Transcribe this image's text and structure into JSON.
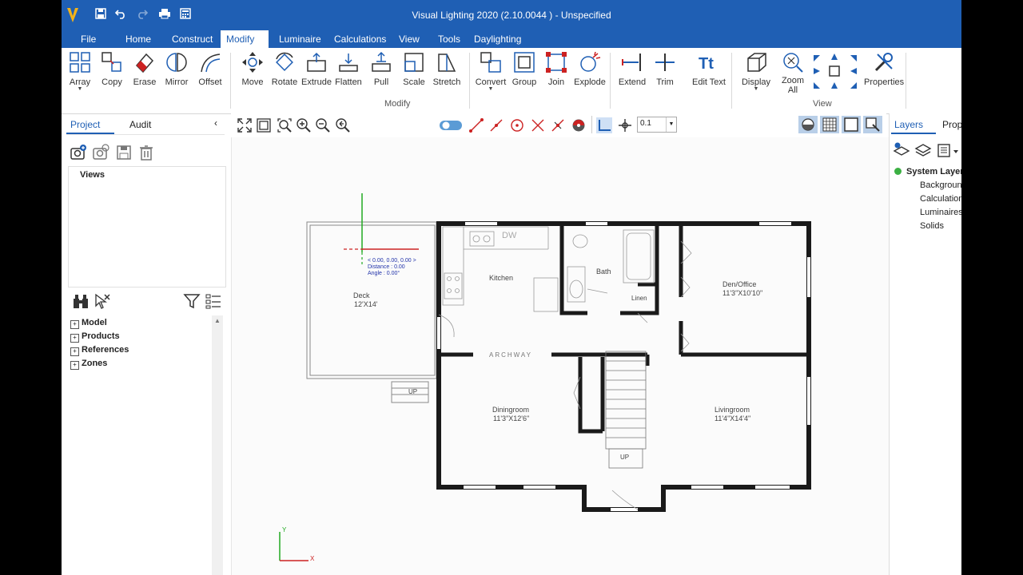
{
  "titlebar": {
    "title": "Visual Lighting 2020 (2.10.0044 ) - Unspecified"
  },
  "menu": [
    "File",
    "Home",
    "Construct",
    "Modify",
    "Luminaire",
    "Calculations",
    "View",
    "Tools",
    "Daylighting"
  ],
  "ribbon": {
    "tools": [
      "Array",
      "Copy",
      "Erase",
      "Mirror",
      "Offset",
      "Move",
      "Rotate",
      "Extrude",
      "Flatten",
      "Pull",
      "Scale",
      "Stretch",
      "Convert",
      "Group",
      "Join",
      "Explode",
      "Extend",
      "Trim",
      "Edit Text",
      "Display",
      "Zoom",
      "All",
      "Properties"
    ],
    "groups": {
      "modify": "Modify",
      "view": "View"
    }
  },
  "left_panel": {
    "tabs": [
      "Project",
      "Audit"
    ],
    "views_label": "Views",
    "tree": [
      "Model",
      "Products",
      "References",
      "Zones"
    ]
  },
  "canvas_toolbar": {
    "step_value": "0.1"
  },
  "right_panel": {
    "tabs": [
      "Layers",
      "Prop"
    ],
    "layers": [
      "System Layer",
      "Background",
      "Calculation",
      "Luminaires",
      "Solids"
    ]
  },
  "floorplan": {
    "rooms": {
      "deck": "Deck",
      "deck_dim": "12'X14'",
      "kitchen": "Kitchen",
      "dw": "DW",
      "bath": "Bath",
      "linen": "Linen",
      "den": "Den/Office",
      "den_dim": "11'3\"X10'10\"",
      "archway": "ARCHWAY",
      "dining": "Diningroom",
      "dining_dim": "11'3\"X12'6\"",
      "living": "Livingroom",
      "living_dim": "11'4\"X14'4\"",
      "up": "UP"
    },
    "cursor": {
      "coords": "< 0.00, 0.00, 0.00 >",
      "distance": "Distance : 0.00",
      "angle": "Angle : 0.00°"
    },
    "axes": {
      "x": "X",
      "y": "Y"
    }
  },
  "colors": {
    "accent": "#1f5fb4",
    "toolbar_blue": "#1f5fb4",
    "icon_red": "#cc2222"
  }
}
